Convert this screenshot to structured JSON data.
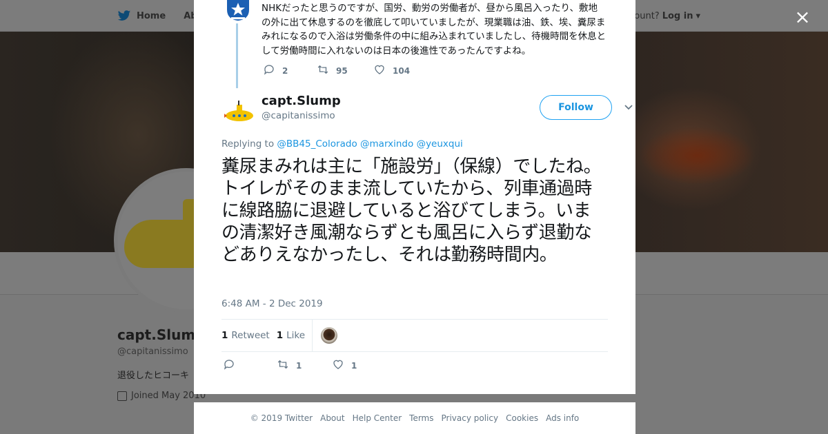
{
  "background": {
    "nav": {
      "home_label": "Home",
      "about_label": "Abo",
      "account_text": "ccount?",
      "login_label": "Log in"
    },
    "profile": {
      "name": "capt.Slump",
      "handle": "@capitanissimo",
      "bio": "退役したヒコーキ",
      "joined": "Joined May 2010"
    }
  },
  "close_label": "×",
  "parent_tweet": {
    "text": "NHKだったと思うのですが、国労、動労の労働者が、昼から風呂入ったり、敷地の外に出て休息するのを徹底して叩いていましたが、現業職は油、鉄、埃、糞尿まみれになるので入浴は労働条件の中に組み込まれていましたし、待機時間を休息として労働時間に入れないのは日本の後進性であったんですよね。",
    "replies": "2",
    "retweets": "95",
    "likes": "104"
  },
  "tweet": {
    "author_name": "capt.Slump",
    "author_handle": "@capitanissimo",
    "follow_label": "Follow",
    "replying_prefix": "Replying to",
    "mentions": [
      "@BB45_Colorado",
      "@marxindo",
      "@yeuxqui"
    ],
    "text": "糞尿まみれは主に「施設労」（保線）でしたね。トイレがそのまま流していたから、列車通過時に線路脇に退避していると浴びてしまう。いまの清潔好き風潮ならずとも風呂に入らず退勤などありえなかったし、それは勤務時間内。",
    "timestamp": "6:48 AM - 2 Dec 2019",
    "retweet_count": "1",
    "retweet_label": "Retweet",
    "like_count": "1",
    "like_label": "Like",
    "actions": {
      "retweets": "1",
      "likes": "1"
    }
  },
  "footer": {
    "links": [
      "© 2019 Twitter",
      "About",
      "Help Center",
      "Terms",
      "Privacy policy",
      "Cookies",
      "Ads info"
    ]
  },
  "colors": {
    "accent": "#1da1f2",
    "link": "#1b95e0",
    "muted": "#657786",
    "text": "#14171a"
  }
}
